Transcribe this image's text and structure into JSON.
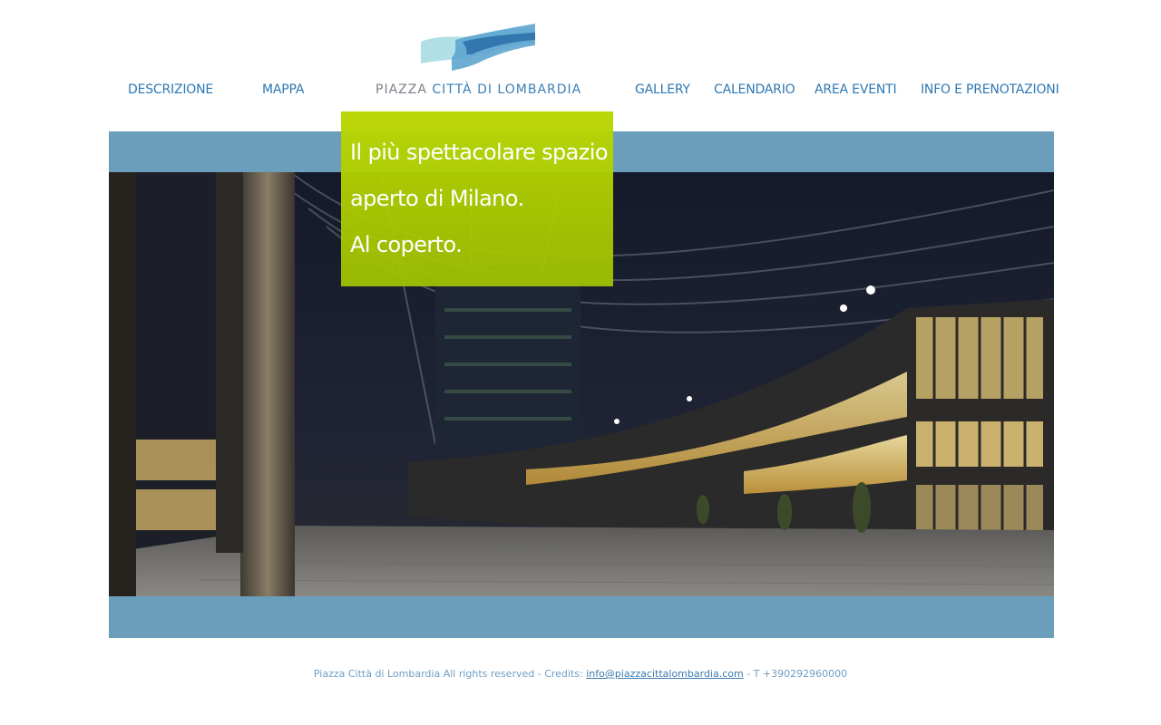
{
  "nav": {
    "left": [
      {
        "label": "DESCRIZIONE"
      },
      {
        "label": "MAPPA"
      }
    ],
    "right": [
      {
        "label": "GALLERY"
      },
      {
        "label": "CALENDARIO"
      },
      {
        "label": "AREA EVENTI"
      },
      {
        "label": "INFO E PRENOTAZIONI"
      }
    ]
  },
  "logo": {
    "text_part1": "PIAZZA",
    "text_part2": "CITTÀ DI LOMBARDIA",
    "colors": {
      "wave_light": "#a8dbe3",
      "wave_mid": "#5ea5cf",
      "wave_dark": "#2f74ad"
    }
  },
  "hero": {
    "tagline": [
      "Il più spettacolare spazio",
      "aperto di Milano.",
      "Al coperto."
    ],
    "image_alt": "night view of piazza città di lombardia",
    "colors": {
      "frame": "#6b9ebb",
      "tagline_bg": "#b4d400"
    }
  },
  "footer": {
    "text_before": "Piazza Città di Lombardia All rights reserved - Credits: ",
    "email": "info@piazzacittalombardia.com",
    "text_after": " - T +390292960000"
  }
}
